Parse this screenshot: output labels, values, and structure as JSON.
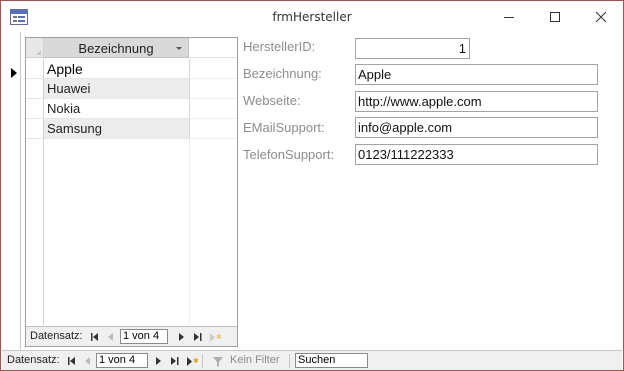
{
  "window": {
    "title": "frmHersteller"
  },
  "subform": {
    "column_header": "Bezeichnung",
    "rows": [
      "Apple",
      "Huawei",
      "Nokia",
      "Samsung"
    ],
    "nav": {
      "label": "Datensatz:",
      "record_position": "1 von 4"
    }
  },
  "fields": {
    "hersteller_id": {
      "label": "HerstellerID:",
      "value": "1"
    },
    "bezeichnung": {
      "label": "Bezeichnung:",
      "value": "Apple"
    },
    "webseite": {
      "label": "Webseite:",
      "value": "http://www.apple.com"
    },
    "email_support": {
      "label": "EMailSupport:",
      "value": "info@apple.com"
    },
    "telefon_support": {
      "label": "TelefonSupport:",
      "value": "0123/111222333"
    }
  },
  "main_nav": {
    "label": "Datensatz:",
    "record_position": "1 von 4",
    "filter_label": "Kein Filter",
    "search_value": "Suchen"
  },
  "icons": {
    "app": "form-icon",
    "first": "first-record-icon",
    "prev": "previous-record-icon",
    "next": "next-record-icon",
    "last": "last-record-icon",
    "new": "new-record-icon",
    "filter": "filter-icon"
  },
  "colors": {
    "window_border": "#a6564e",
    "label_text": "#8d8d8d",
    "header_bg": "#d9d9d9",
    "alt_row_bg": "#ececec",
    "nav_bg": "#f0f0f0"
  }
}
